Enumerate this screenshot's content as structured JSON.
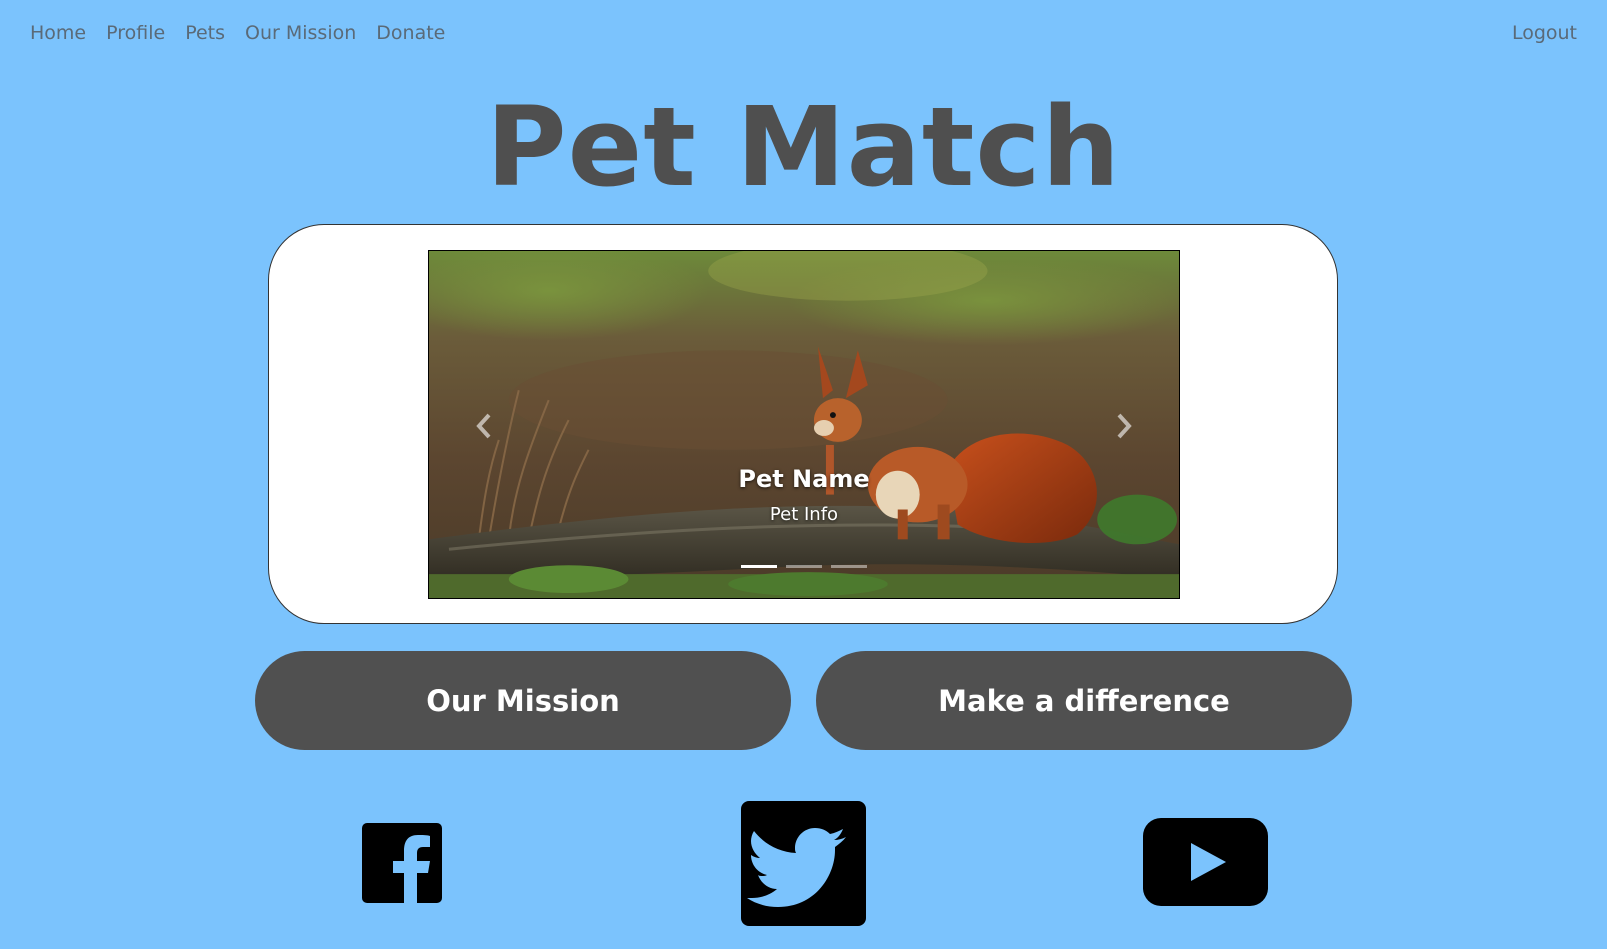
{
  "nav": {
    "items": [
      {
        "label": "Home"
      },
      {
        "label": "Profile"
      },
      {
        "label": "Pets"
      },
      {
        "label": "Our Mission"
      },
      {
        "label": "Donate"
      }
    ],
    "logout_label": "Logout"
  },
  "page": {
    "title": "Pet Match",
    "background_color": "#7bc3fd"
  },
  "carousel": {
    "slide": {
      "name": "Pet Name",
      "info": "Pet Info",
      "image": "squirrel-on-log"
    },
    "indicators": {
      "count": 3,
      "active_index": 0
    },
    "prev_icon": "chevron-left-icon",
    "next_icon": "chevron-right-icon"
  },
  "actions": {
    "mission_label": "Our Mission",
    "difference_label": "Make a difference",
    "button_color": "#505050"
  },
  "social": {
    "items": [
      {
        "icon": "facebook-icon"
      },
      {
        "icon": "twitter-icon"
      },
      {
        "icon": "youtube-icon"
      }
    ]
  }
}
